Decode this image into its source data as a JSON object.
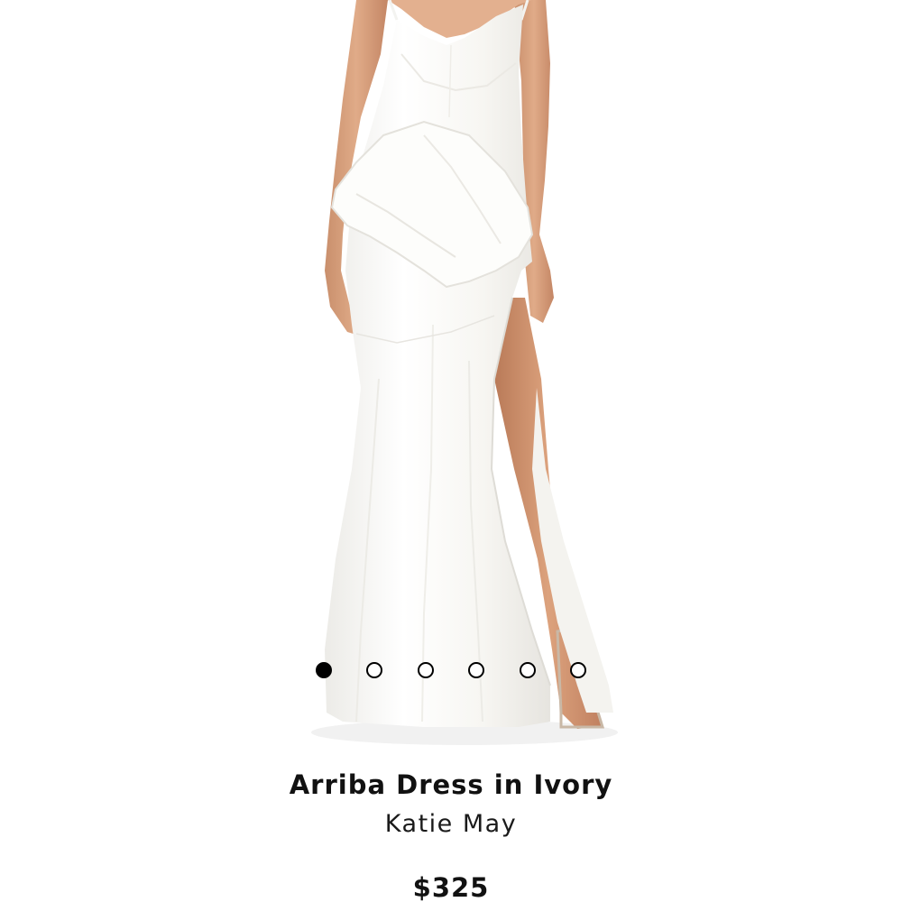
{
  "product": {
    "title": "Arriba Dress in Ivory",
    "brand": "Katie May",
    "price": "$325"
  },
  "gallery": {
    "image": "white-gown-photo",
    "dots": [
      {
        "active": true
      },
      {
        "active": false
      },
      {
        "active": false
      },
      {
        "active": false
      },
      {
        "active": false
      },
      {
        "active": false
      }
    ]
  },
  "colors": {
    "background": "#ffffff",
    "text": "#111111",
    "dress": "#fbfaf7",
    "skin": "#d9a27f"
  }
}
